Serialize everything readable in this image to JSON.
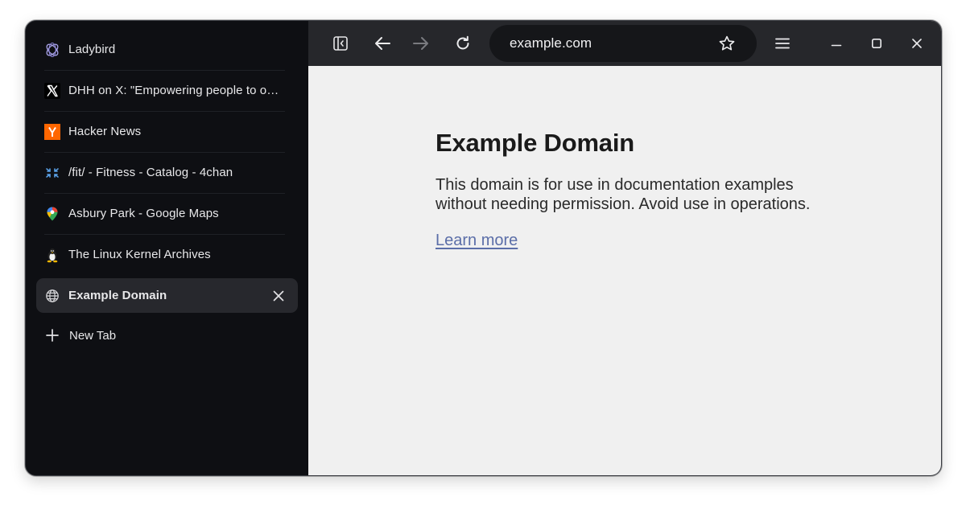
{
  "sidebar": {
    "tabs": [
      {
        "label": "Ladybird",
        "icon": "ladybird-icon"
      },
      {
        "label": "DHH on X: \"Empowering people to o…",
        "icon": "x-logo-icon"
      },
      {
        "label": "Hacker News",
        "icon": "hacker-news-icon"
      },
      {
        "label": "/fit/ - Fitness - Catalog - 4chan",
        "icon": "4chan-icon"
      },
      {
        "label": "Asbury Park - Google Maps",
        "icon": "google-maps-icon"
      },
      {
        "label": "The Linux Kernel Archives",
        "icon": "linux-tux-icon"
      },
      {
        "label": "Example Domain",
        "icon": "globe-icon",
        "active": true
      }
    ],
    "new_tab_label": "New Tab"
  },
  "toolbar": {
    "url": "example.com"
  },
  "page": {
    "heading": "Example Domain",
    "paragraph": "This domain is for use in documentation examples without needing permission. Avoid use in operations.",
    "link": "Learn more"
  },
  "colors": {
    "sidebar_bg": "#0e0f13",
    "toolbar_bg": "#26272b",
    "url_bar_bg": "#151619",
    "content_bg": "#f0f0f0",
    "link": "#5b6ea8",
    "hacker_news_orange": "#ff6600"
  }
}
